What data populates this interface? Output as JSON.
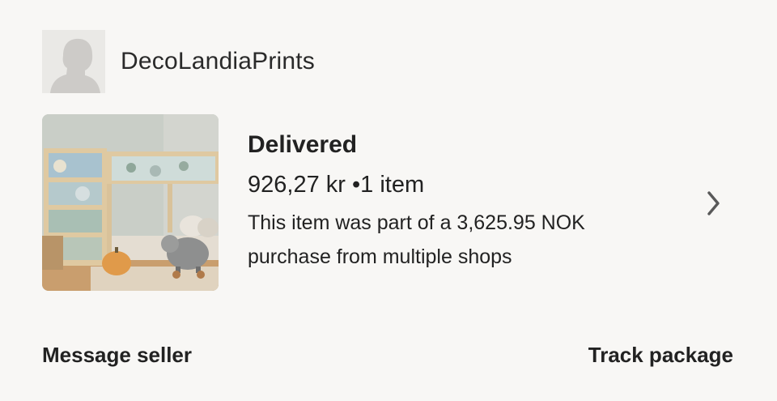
{
  "shop": {
    "name": "DecoLandiaPrints",
    "avatar_icon": "default-avatar-silhouette"
  },
  "order": {
    "status": "Delivered",
    "price": "926,27 kr",
    "separator": "•",
    "item_count": "1 item",
    "note": "This item was part of a 3,625.95 NOK purchase from multiple shops",
    "chevron_icon": "chevron-right-icon"
  },
  "actions": {
    "message_seller": "Message seller",
    "track_package": "Track package"
  },
  "colors": {
    "background": "#f8f7f5",
    "text": "#222222",
    "chevron": "#595959"
  }
}
